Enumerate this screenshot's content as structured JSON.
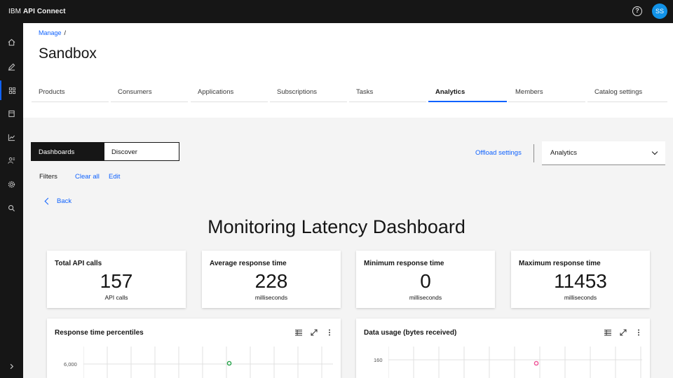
{
  "app": {
    "brand_prefix": "IBM",
    "brand_name": "API Connect",
    "avatar_initials": "SS"
  },
  "breadcrumb": {
    "parent": "Manage",
    "separator": "/"
  },
  "page": {
    "title": "Sandbox"
  },
  "tabs": [
    {
      "label": "Products"
    },
    {
      "label": "Consumers"
    },
    {
      "label": "Applications"
    },
    {
      "label": "Subscriptions"
    },
    {
      "label": "Tasks"
    },
    {
      "label": "Analytics",
      "active": true
    },
    {
      "label": "Members"
    },
    {
      "label": "Catalog settings"
    }
  ],
  "view_toggle": {
    "dashboards": "Dashboards",
    "discover": "Discover",
    "selected": "Dashboards"
  },
  "offload_settings": "Offload settings",
  "analytics_select": {
    "value": "Analytics"
  },
  "filters": {
    "label": "Filters",
    "clear_all": "Clear all",
    "edit": "Edit"
  },
  "back": "Back",
  "dashboard": {
    "title": "Monitoring Latency Dashboard",
    "kpis": [
      {
        "label": "Total API calls",
        "value": "157",
        "unit": "API calls"
      },
      {
        "label": "Average response time",
        "value": "228",
        "unit": "milliseconds"
      },
      {
        "label": "Minimum response time",
        "value": "0",
        "unit": "milliseconds"
      },
      {
        "label": "Maximum response time",
        "value": "11453",
        "unit": "milliseconds"
      }
    ],
    "charts": [
      {
        "title": "Response time percentiles",
        "y_tick": "6,000",
        "marker_color": "#24a148"
      },
      {
        "title": "Data usage (bytes received)",
        "y_tick": "160",
        "marker_color": "#ee5396"
      }
    ]
  },
  "colors": {
    "accent": "#0f62fe",
    "topbar": "#161616",
    "avatar": "#1192e8"
  },
  "icons": {
    "nav": [
      "home-icon",
      "edit-icon",
      "catalog-icon",
      "api-icon",
      "analytics-icon",
      "members-icon",
      "settings-icon",
      "search-icon",
      "expand-icon"
    ],
    "chart_tools": [
      "table-icon",
      "maximize-icon",
      "overflow-menu-icon"
    ]
  }
}
